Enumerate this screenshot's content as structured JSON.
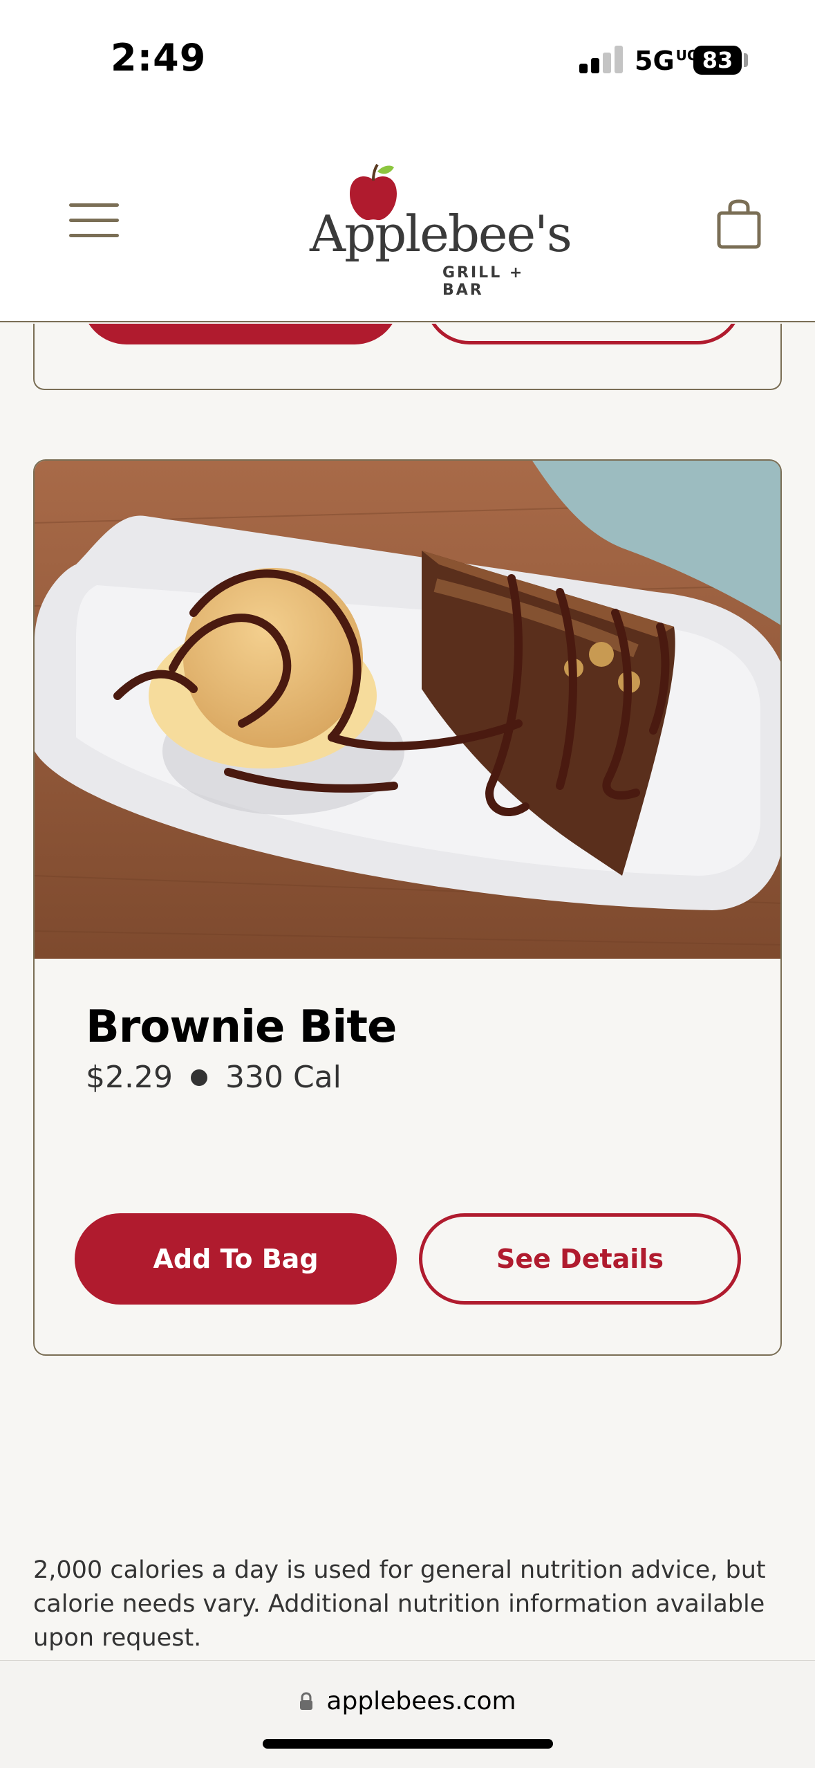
{
  "status_bar": {
    "time": "2:49",
    "network": "5G",
    "network_suffix": "UC",
    "battery": "83"
  },
  "header": {
    "logo_text": "Applebee's",
    "logo_subtext": "GRILL + BAR",
    "menu_icon": "hamburger-menu-icon",
    "bag_icon": "shopping-bag-icon"
  },
  "product": {
    "name": "Brownie Bite",
    "price": "$2.29",
    "calories": "330 Cal",
    "add_label": "Add To Bag",
    "details_label": "See Details"
  },
  "disclaimer": "2,000 calories a day is used for general nutrition advice, but calorie needs vary. Additional nutrition information available upon request.",
  "browser": {
    "url": "applebees.com",
    "lock_icon": "lock-icon"
  },
  "colors": {
    "brand_red": "#b01b2e",
    "accent_olive": "#7a6e55",
    "background": "#f7f6f3"
  }
}
